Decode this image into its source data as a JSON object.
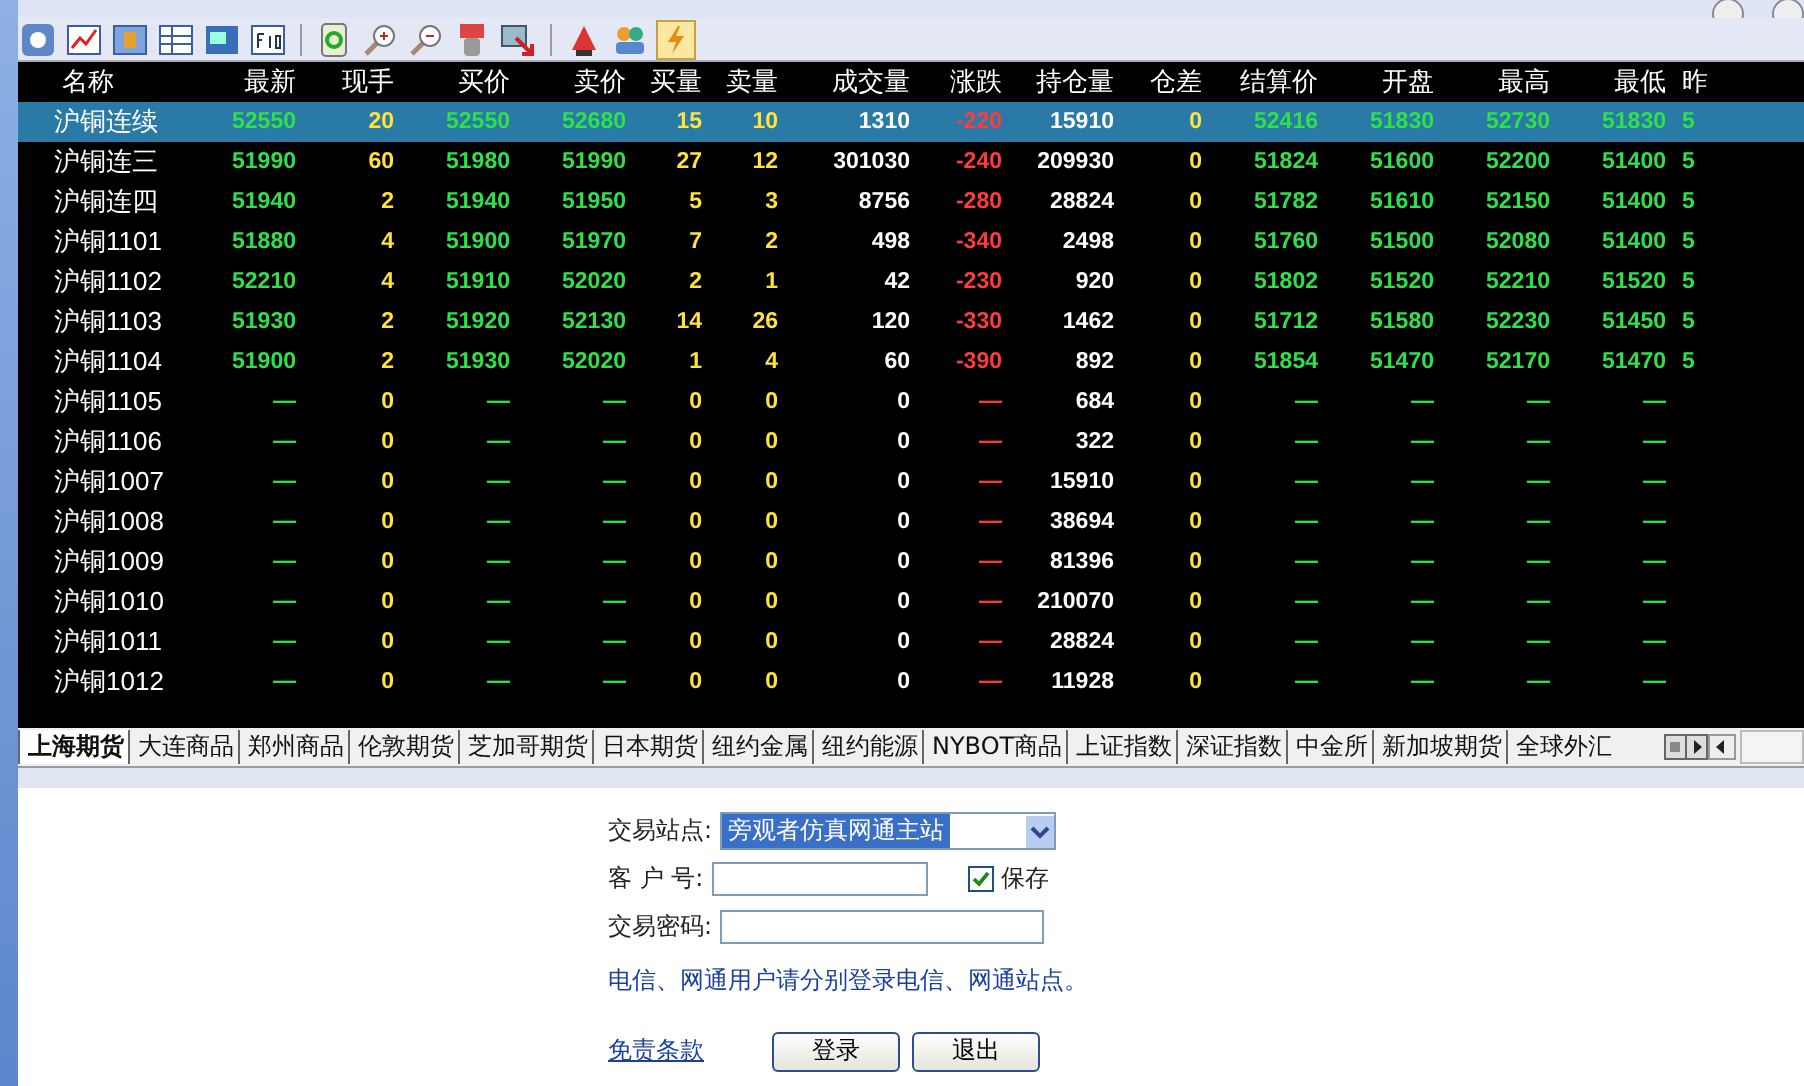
{
  "table": {
    "columns": [
      {
        "label": "名称",
        "kind": "name"
      },
      {
        "label": "最新",
        "kind": "price"
      },
      {
        "label": "现手",
        "kind": "qty"
      },
      {
        "label": "买价",
        "kind": "price"
      },
      {
        "label": "卖价",
        "kind": "price"
      },
      {
        "label": "买量",
        "kind": "qty"
      },
      {
        "label": "卖量",
        "kind": "qty"
      },
      {
        "label": "成交量",
        "kind": "vol"
      },
      {
        "label": "涨跌",
        "kind": "change"
      },
      {
        "label": "持仓量",
        "kind": "vol"
      },
      {
        "label": "仓差",
        "kind": "qty"
      },
      {
        "label": "结算价",
        "kind": "price"
      },
      {
        "label": "开盘",
        "kind": "price"
      },
      {
        "label": "最高",
        "kind": "price"
      },
      {
        "label": "最低",
        "kind": "price"
      },
      {
        "label": "昨",
        "kind": "price"
      }
    ],
    "rows": [
      {
        "selected": true,
        "cells": [
          "沪铜连续",
          "52550",
          "20",
          "52550",
          "52680",
          "15",
          "10",
          "1310",
          "-220",
          "15910",
          "0",
          "52416",
          "51830",
          "52730",
          "51830",
          "5"
        ]
      },
      {
        "selected": false,
        "cells": [
          "沪铜连三",
          "51990",
          "60",
          "51980",
          "51990",
          "27",
          "12",
          "301030",
          "-240",
          "209930",
          "0",
          "51824",
          "51600",
          "52200",
          "51400",
          "5"
        ]
      },
      {
        "selected": false,
        "cells": [
          "沪铜连四",
          "51940",
          "2",
          "51940",
          "51950",
          "5",
          "3",
          "8756",
          "-280",
          "28824",
          "0",
          "51782",
          "51610",
          "52150",
          "51400",
          "5"
        ]
      },
      {
        "selected": false,
        "cells": [
          "沪铜1101",
          "51880",
          "4",
          "51900",
          "51970",
          "7",
          "2",
          "498",
          "-340",
          "2498",
          "0",
          "51760",
          "51500",
          "52080",
          "51400",
          "5"
        ]
      },
      {
        "selected": false,
        "cells": [
          "沪铜1102",
          "52210",
          "4",
          "51910",
          "52020",
          "2",
          "1",
          "42",
          "-230",
          "920",
          "0",
          "51802",
          "51520",
          "52210",
          "51520",
          "5"
        ]
      },
      {
        "selected": false,
        "cells": [
          "沪铜1103",
          "51930",
          "2",
          "51920",
          "52130",
          "14",
          "26",
          "120",
          "-330",
          "1462",
          "0",
          "51712",
          "51580",
          "52230",
          "51450",
          "5"
        ]
      },
      {
        "selected": false,
        "cells": [
          "沪铜1104",
          "51900",
          "2",
          "51930",
          "52020",
          "1",
          "4",
          "60",
          "-390",
          "892",
          "0",
          "51854",
          "51470",
          "52170",
          "51470",
          "5"
        ]
      },
      {
        "selected": false,
        "cells": [
          "沪铜1105",
          "—",
          "0",
          "—",
          "—",
          "0",
          "0",
          "0",
          "—",
          "684",
          "0",
          "—",
          "—",
          "—",
          "—"
        ]
      },
      {
        "selected": false,
        "cells": [
          "沪铜1106",
          "—",
          "0",
          "—",
          "—",
          "0",
          "0",
          "0",
          "—",
          "322",
          "0",
          "—",
          "—",
          "—",
          "—"
        ]
      },
      {
        "selected": false,
        "cells": [
          "沪铜1007",
          "—",
          "0",
          "—",
          "—",
          "0",
          "0",
          "0",
          "—",
          "15910",
          "0",
          "—",
          "—",
          "—",
          "—"
        ]
      },
      {
        "selected": false,
        "cells": [
          "沪铜1008",
          "—",
          "0",
          "—",
          "—",
          "0",
          "0",
          "0",
          "—",
          "38694",
          "0",
          "—",
          "—",
          "—",
          "—"
        ]
      },
      {
        "selected": false,
        "cells": [
          "沪铜1009",
          "—",
          "0",
          "—",
          "—",
          "0",
          "0",
          "0",
          "—",
          "81396",
          "0",
          "—",
          "—",
          "—",
          "—"
        ]
      },
      {
        "selected": false,
        "cells": [
          "沪铜1010",
          "—",
          "0",
          "—",
          "—",
          "0",
          "0",
          "0",
          "—",
          "210070",
          "0",
          "—",
          "—",
          "—",
          "—"
        ]
      },
      {
        "selected": false,
        "cells": [
          "沪铜1011",
          "—",
          "0",
          "—",
          "—",
          "0",
          "0",
          "0",
          "—",
          "28824",
          "0",
          "—",
          "—",
          "—",
          "—"
        ]
      },
      {
        "selected": false,
        "cells": [
          "沪铜1012",
          "—",
          "0",
          "—",
          "—",
          "0",
          "0",
          "0",
          "—",
          "11928",
          "0",
          "—",
          "—",
          "—",
          "—"
        ]
      }
    ]
  },
  "market_tabs": [
    {
      "label": "上海期货",
      "selected": true
    },
    {
      "label": "大连商品",
      "selected": false
    },
    {
      "label": "郑州商品",
      "selected": false
    },
    {
      "label": "伦敦期货",
      "selected": false
    },
    {
      "label": "芝加哥期货",
      "selected": false
    },
    {
      "label": "日本期货",
      "selected": false
    },
    {
      "label": "纽约金属",
      "selected": false
    },
    {
      "label": "纽约能源",
      "selected": false
    },
    {
      "label": "NYBOT商品",
      "selected": false
    },
    {
      "label": "上证指数",
      "selected": false
    },
    {
      "label": "深证指数",
      "selected": false
    },
    {
      "label": "中金所",
      "selected": false
    },
    {
      "label": "新加坡期货",
      "selected": false
    },
    {
      "label": "全球外汇",
      "selected": false
    }
  ],
  "login": {
    "station_label": "交易站点:",
    "station_value": "旁观者仿真网通主站",
    "client_label": "客 户 号:",
    "save_label": "保存",
    "save_checked": true,
    "password_label": "交易密码:",
    "note": "电信、网通用户请分别登录电信、网通站点。",
    "disclaimer_link": "免责条款",
    "buttons": [
      "登录",
      "退出"
    ]
  }
}
